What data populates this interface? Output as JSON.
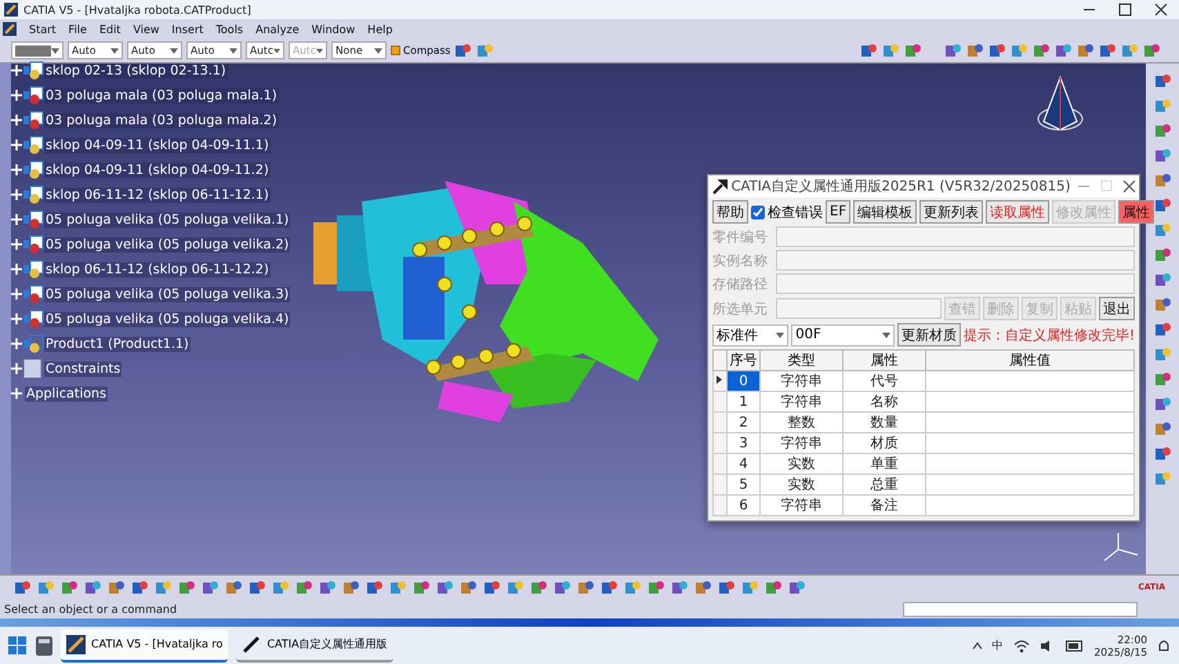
{
  "window": {
    "title": "CATIA V5 - [Hvataljka robota.CATProduct]"
  },
  "menu": [
    "Start",
    "File",
    "Edit",
    "View",
    "Insert",
    "Tools",
    "Analyze",
    "Window",
    "Help"
  ],
  "toolbar": {
    "fields": [
      {
        "kind": "swatch"
      },
      {
        "kind": "text",
        "value": "Auto",
        "disabled": false
      },
      {
        "kind": "text",
        "value": "Auto",
        "disabled": false
      },
      {
        "kind": "text",
        "value": "Auto",
        "disabled": false
      },
      {
        "kind": "text",
        "value": "Autc",
        "disabled": false
      },
      {
        "kind": "text",
        "value": "Autc",
        "disabled": true
      },
      {
        "kind": "text",
        "value": "None",
        "disabled": false
      }
    ],
    "compass": {
      "label": "Compass",
      "checked": true
    }
  },
  "tree": [
    {
      "label": "sklop 02-13 (sklop 02-13.1)",
      "kind": "product"
    },
    {
      "label": "03 poluga mala (03 poluga mala.1)",
      "kind": "part"
    },
    {
      "label": "03 poluga mala (03 poluga mala.2)",
      "kind": "part"
    },
    {
      "label": "sklop 04-09-11 (sklop 04-09-11.1)",
      "kind": "product"
    },
    {
      "label": "sklop 04-09-11 (sklop 04-09-11.2)",
      "kind": "product"
    },
    {
      "label": "sklop 06-11-12 (sklop 06-11-12.1)",
      "kind": "product"
    },
    {
      "label": "05 poluga velika (05 poluga velika.1)",
      "kind": "part"
    },
    {
      "label": "05 poluga velika (05 poluga velika.2)",
      "kind": "part"
    },
    {
      "label": "sklop 06-11-12 (sklop 06-11-12.2)",
      "kind": "product"
    },
    {
      "label": "05 poluga velika (05 poluga velika.3)",
      "kind": "part"
    },
    {
      "label": "05 poluga velika (05 poluga velika.4)",
      "kind": "part"
    },
    {
      "label": "Product1 (Product1.1)",
      "kind": "subproduct"
    },
    {
      "label": "Constraints",
      "kind": "constraints"
    },
    {
      "label": "Applications",
      "kind": "applications"
    }
  ],
  "dialog": {
    "title": "CATIA自定义属性通用版2025R1  (V5R32/20250815)",
    "top_buttons": [
      {
        "label": "帮助",
        "kind": "button",
        "disabled": false,
        "accent": false
      },
      {
        "label": "检查错误",
        "kind": "checkbox",
        "checked": true
      },
      {
        "label": "EF",
        "kind": "button",
        "disabled": false,
        "accent": false
      },
      {
        "label": "编辑模板",
        "kind": "button",
        "disabled": false,
        "accent": false
      },
      {
        "label": "更新列表",
        "kind": "button",
        "disabled": false,
        "accent": false
      },
      {
        "label": "读取属性",
        "kind": "button",
        "disabled": false,
        "accent": false,
        "red_text": true
      },
      {
        "label": "修改属性",
        "kind": "button",
        "disabled": true,
        "accent": false
      },
      {
        "label": "属性",
        "kind": "button",
        "disabled": false,
        "accent": true
      }
    ],
    "fields": [
      {
        "label": "零件编号"
      },
      {
        "label": "实例名称"
      },
      {
        "label": "存储路径"
      },
      {
        "label": "所选单元"
      }
    ],
    "cell_buttons": [
      {
        "label": "查错",
        "disabled": true
      },
      {
        "label": "删除",
        "disabled": true
      },
      {
        "label": "复制",
        "disabled": true
      },
      {
        "label": "粘贴",
        "disabled": true
      },
      {
        "label": "退出",
        "disabled": false
      }
    ],
    "category": {
      "value": "标准件"
    },
    "material": {
      "value": "00F"
    },
    "update_material": "更新材质",
    "hint": "提示：自定义属性修改完毕!",
    "columns": [
      "序号",
      "类型",
      "属性",
      "属性值"
    ],
    "rows": [
      {
        "index": "0",
        "type": "字符串",
        "property": "代号",
        "selected": true
      },
      {
        "index": "1",
        "type": "字符串",
        "property": "名称",
        "selected": false
      },
      {
        "index": "2",
        "type": "整数",
        "property": "数量",
        "selected": false
      },
      {
        "index": "3",
        "type": "字符串",
        "property": "材质",
        "selected": false
      },
      {
        "index": "4",
        "type": "实数",
        "property": "单重",
        "selected": false
      },
      {
        "index": "5",
        "type": "实数",
        "property": "总重",
        "selected": false
      },
      {
        "index": "6",
        "type": "字符串",
        "property": "备注",
        "selected": false
      }
    ]
  },
  "status_bar": {
    "prompt": "Select an object or a command"
  },
  "logo": "CATIA",
  "taskbar": {
    "tasks": [
      {
        "label": "CATIA V5 - [Hvataljka ro",
        "selected": true
      },
      {
        "label": "CATIA自定义属性通用版",
        "selected": false
      }
    ],
    "ime": "中",
    "time": "22:00",
    "date": "2025/8/15"
  }
}
